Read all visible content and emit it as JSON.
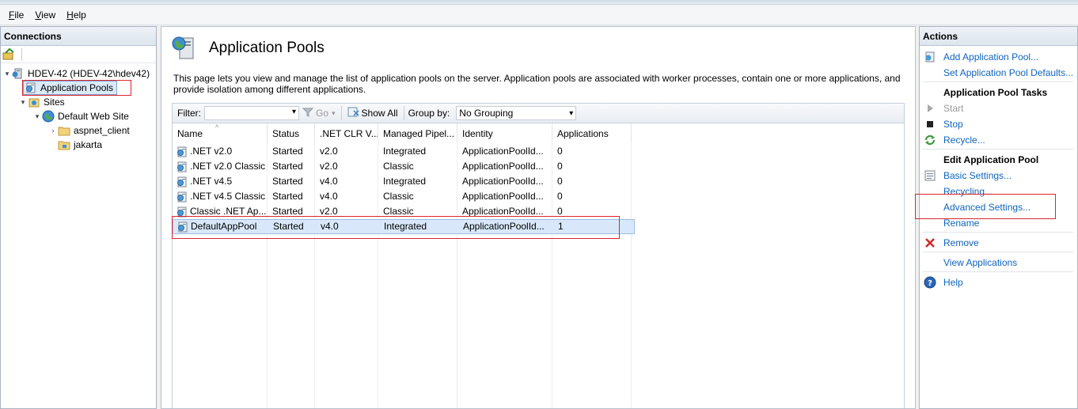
{
  "menu": {
    "file": {
      "u": "F",
      "rest": "ile"
    },
    "view": {
      "u": "V",
      "rest": "iew"
    },
    "help": {
      "u": "H",
      "rest": "elp"
    }
  },
  "connections": {
    "title": "Connections",
    "tree": {
      "server": "HDEV-42 (HDEV-42\\hdev42)",
      "app_pools": "Application Pools",
      "sites": "Sites",
      "default_site": "Default Web Site",
      "children": [
        "aspnet_client",
        "jakarta"
      ]
    }
  },
  "center": {
    "title": "Application Pools",
    "description": "This page lets you view and manage the list of application pools on the server. Application pools are associated with worker processes, contain one or more applications, and provide isolation among different applications.",
    "filterbar": {
      "filter_label": "Filter:",
      "filter_value": "",
      "go_label": "Go",
      "show_all_label": "Show All",
      "group_by_label": "Group by:",
      "group_by_value": "No Grouping"
    },
    "columns": [
      "Name",
      "Status",
      ".NET CLR V...",
      "Managed Pipel...",
      "Identity",
      "Applications"
    ],
    "rows": [
      [
        "NET v2.0",
        "Started",
        "v2.0",
        "Integrated",
        "ApplicationPoolId...",
        "0"
      ],
      [
        "NET v2.0 Classic",
        "Started",
        "v2.0",
        "Classic",
        "ApplicationPoolId...",
        "0"
      ],
      [
        "NET v4.5",
        "Started",
        "v4.0",
        "Integrated",
        "ApplicationPoolId...",
        "0"
      ],
      [
        "NET v4.5 Classic",
        "Started",
        "v4.0",
        "Classic",
        "ApplicationPoolId...",
        "0"
      ],
      [
        "Classic .NET Ap...",
        "Started",
        "v2.0",
        "Classic",
        "ApplicationPoolId...",
        "0"
      ],
      [
        "DefaultAppPool",
        "Started",
        "v4.0",
        "Integrated",
        "ApplicationPoolId...",
        "1"
      ]
    ],
    "row_prefixes": [
      ".",
      ".",
      ".",
      ".",
      "",
      ""
    ]
  },
  "actions": {
    "title": "Actions",
    "add_pool": "Add Application Pool...",
    "set_defaults": "Set Application Pool Defaults...",
    "tasks_heading": "Application Pool Tasks",
    "start": "Start",
    "stop": "Stop",
    "recycle": "Recycle...",
    "edit_heading": "Edit Application Pool",
    "basic_settings": "Basic Settings...",
    "recycling": "Recycling...",
    "advanced_settings": "Advanced Settings...",
    "rename": "Rename",
    "remove": "Remove",
    "view_applications": "View Applications",
    "help": "Help"
  },
  "colors": {
    "link": "#0e64be",
    "annotation": "#d8262e",
    "selection": "#d8e8fa"
  }
}
